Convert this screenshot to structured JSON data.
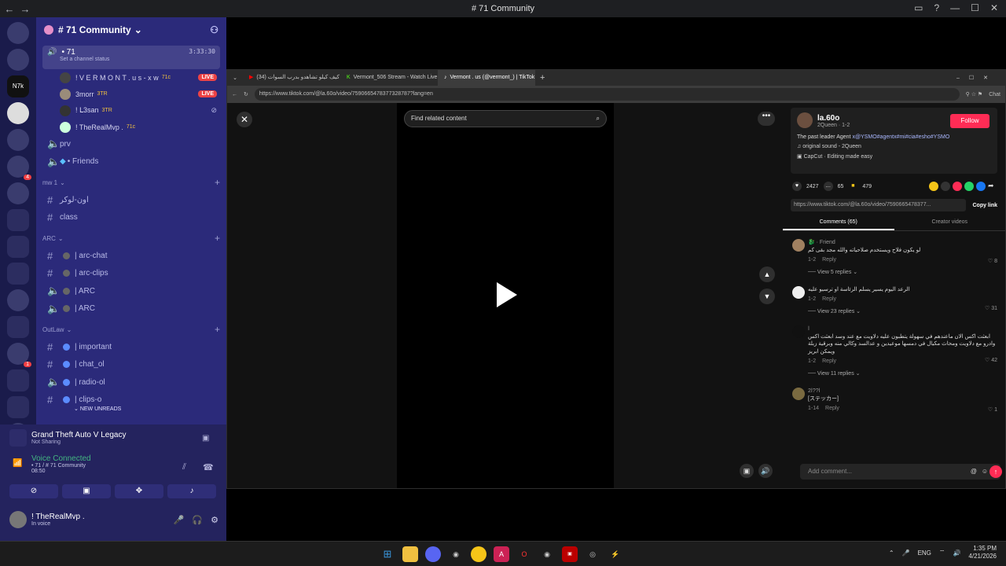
{
  "window": {
    "title": "# 71 Community"
  },
  "server": {
    "name": "# 71 Community"
  },
  "voice_active": {
    "name": "• 71",
    "time": "3:33:30",
    "status": "Set a channel status"
  },
  "members": [
    {
      "name": "! V E R M O N T . u s - x w",
      "tag": "71c",
      "live": "LIVE"
    },
    {
      "name": "3morr",
      "tag": "3TR",
      "live": "LIVE"
    },
    {
      "name": "! ᒪ3san",
      "tag": "3TR",
      "live": ""
    },
    {
      "name": "! TheRealMvp .",
      "tag": "71c",
      "live": ""
    }
  ],
  "channels_top": [
    {
      "icon": "speaker",
      "name": "prv"
    },
    {
      "icon": "speaker",
      "name": "• Friends"
    }
  ],
  "categories": [
    {
      "name": "mw 1",
      "channels": [
        {
          "name": "اون-لوكر",
          "dot": ""
        },
        {
          "name": "class",
          "dot": ""
        }
      ]
    },
    {
      "name": "ARC",
      "channels": [
        {
          "name": "| arc-chat",
          "dot": "gray"
        },
        {
          "name": "| arc-clips",
          "dot": "gray"
        },
        {
          "name": "| ARC",
          "dot": "gray"
        },
        {
          "name": "| ARC",
          "dot": "gray"
        }
      ]
    },
    {
      "name": "OutLaw",
      "channels": [
        {
          "name": "| important",
          "dot": "blue"
        },
        {
          "name": "| chat_ol",
          "dot": "blue"
        },
        {
          "name": "| radio-ol",
          "dot": "blue"
        },
        {
          "name": "| clips-o",
          "dot": "blue"
        }
      ]
    }
  ],
  "new_unreads": "NEW UNREADS",
  "game": {
    "title": "Grand Theft Auto V Legacy",
    "sub": "Not Sharing"
  },
  "voice": {
    "label": "Voice Connected",
    "channel": "• 71 / # 71 Community",
    "time": "08:50"
  },
  "user": {
    "name": "! TheRealMvp .",
    "status": "In voice"
  },
  "browser": {
    "tabs": [
      {
        "label": "(34) كيف كيلو تشاهدو بدرب السوات",
        "x": "×"
      },
      {
        "label": "Vermont_506 Stream - Watch Live",
        "x": "×"
      },
      {
        "label": "Vermont . us (@vermont_) | TikTok",
        "x": "×"
      }
    ],
    "url": "https://www.tiktok.com/@la.60o/video/7590665478377328787?lang=en",
    "chat": "Chat"
  },
  "video": {
    "search_placeholder": "Find related content"
  },
  "author": {
    "name": "la.60o",
    "sub": "2Queen · 1-2",
    "follow": "Follow"
  },
  "desc": {
    "text": "The past leader Agent ",
    "tags": "x@YSMO#agentx#mi#cia#esho#YSMO"
  },
  "sound": "original sound - 2Queen",
  "capcut": "CapCut · Editing made easy",
  "stats": {
    "likes": "2427",
    "comments": "65",
    "saves": "479"
  },
  "link": {
    "url": "https://www.tiktok.com/@la.60o/video/7590665478377...",
    "copy": "Copy link"
  },
  "ctabs": {
    "comments": "Comments (65)",
    "creator": "Creator videos"
  },
  "comments": [
    {
      "user": "🐉 · Friend",
      "text": "لو يكون فلاح ويستخدم صلاحياته والله مجد بقى كم",
      "date": "1-2",
      "reply": "Reply",
      "likes": "8",
      "replies": "View 5 replies"
    },
    {
      "user": "",
      "text": "الرعد اليوم يسير يسلم الرئاسة او ترسيو عليه",
      "date": "1-2",
      "reply": "Reply",
      "likes": "31",
      "replies": "View 23 replies"
    },
    {
      "user": "ا",
      "text": "ابعثت اكس الان ماعندهم في سهولة يتطبون عليه دلاويت مع  عند وسد ابعثت اكس وادرو مع دلاويت ومحاث مكيال في دمسها موعيدين و  عدالسد  وكالي منه وبرقية زبلة ويمكن ابريز",
      "date": "1-2",
      "reply": "Reply",
      "likes": "42",
      "replies": "View 11 replies"
    },
    {
      "user": "ﺍ??ﺍ2",
      "text": "[ステッカー]",
      "date": "1-14",
      "reply": "Reply",
      "likes": "1",
      "replies": ""
    }
  ],
  "add_comment": "Add comment...",
  "tray": {
    "lang": "ENG",
    "time": "1:35 PM",
    "date": "4/21/2026"
  }
}
